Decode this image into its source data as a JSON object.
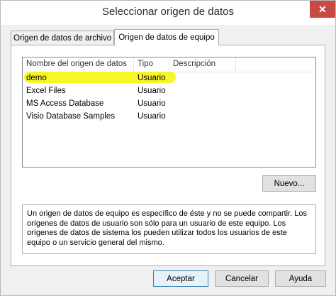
{
  "window": {
    "title": "Seleccionar origen de datos",
    "close_glyph": "✕"
  },
  "tabs": [
    {
      "label": "Origen de datos de archivo",
      "active": false
    },
    {
      "label": "Origen de datos de equipo",
      "active": true
    }
  ],
  "list": {
    "columns": [
      "Nombre del origen de datos",
      "Tipo",
      "Descripción"
    ],
    "rows": [
      {
        "name": "demo",
        "type": "Usuario",
        "description": "",
        "highlighted": true
      },
      {
        "name": "Excel Files",
        "type": "Usuario",
        "description": ""
      },
      {
        "name": "MS Access Database",
        "type": "Usuario",
        "description": ""
      },
      {
        "name": "Visio Database Samples",
        "type": "Usuario",
        "description": ""
      }
    ]
  },
  "buttons": {
    "new": "Nuevo...",
    "accept": "Aceptar",
    "cancel": "Cancelar",
    "help": "Ayuda"
  },
  "description_text": "Un origen de datos de equipo es específico de éste y no se puede compartir. Los orígenes de datos de usuario son sólo para un usuario de este equipo. Los orígenes de datos de sistema los pueden utilizar todos los usuarios de este equipo o un servicio general del mismo.",
  "colors": {
    "highlight": "#f7f400",
    "close_button": "#c74a43",
    "default_button_border": "#3c7fb1"
  }
}
